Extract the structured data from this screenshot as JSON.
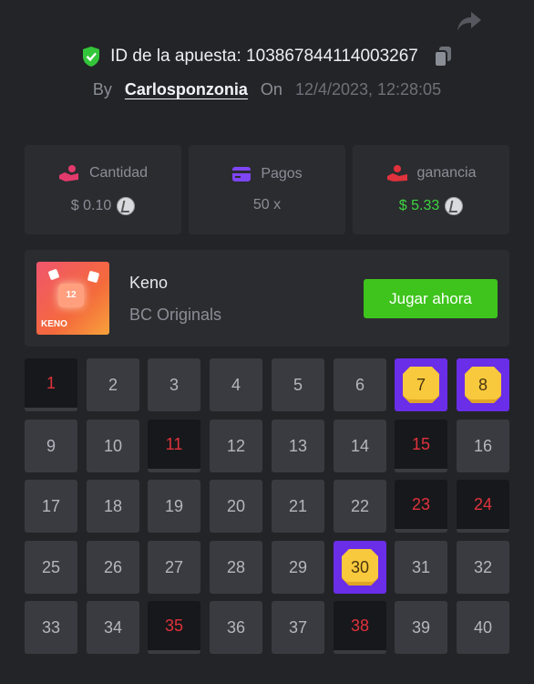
{
  "header": {
    "bet_id_label": "ID de la apuesta: 103867844114003267",
    "by_label": "By",
    "user": "Carlosponzonia",
    "on_label": "On",
    "date": "12/4/2023, 12:28:05"
  },
  "stats": [
    {
      "label": "Cantidad",
      "value": "$ 0.10",
      "icon": "hand-coins-icon"
    },
    {
      "label": "Pagos",
      "value": "50 x",
      "icon": "card-icon"
    },
    {
      "label": "ganancia",
      "value": "$ 5.33",
      "icon": "user-hand-icon"
    }
  ],
  "game": {
    "name": "Keno",
    "provider": "BC Originals",
    "play_label": "Jugar ahora",
    "thumb_number": "12",
    "thumb_label": "KENO"
  },
  "colors": {
    "accent_green": "#3ec41c",
    "hit_purple": "#6a2de8",
    "miss_red": "#e0323c"
  },
  "grid": {
    "cells": [
      {
        "n": "1",
        "s": "miss"
      },
      {
        "n": "2",
        "s": "plain"
      },
      {
        "n": "3",
        "s": "plain"
      },
      {
        "n": "4",
        "s": "plain"
      },
      {
        "n": "5",
        "s": "plain"
      },
      {
        "n": "6",
        "s": "plain"
      },
      {
        "n": "7",
        "s": "hit"
      },
      {
        "n": "8",
        "s": "hit"
      },
      {
        "n": "9",
        "s": "plain"
      },
      {
        "n": "10",
        "s": "plain"
      },
      {
        "n": "11",
        "s": "miss"
      },
      {
        "n": "12",
        "s": "plain"
      },
      {
        "n": "13",
        "s": "plain"
      },
      {
        "n": "14",
        "s": "plain"
      },
      {
        "n": "15",
        "s": "miss"
      },
      {
        "n": "16",
        "s": "plain"
      },
      {
        "n": "17",
        "s": "plain"
      },
      {
        "n": "18",
        "s": "plain"
      },
      {
        "n": "19",
        "s": "plain"
      },
      {
        "n": "20",
        "s": "plain"
      },
      {
        "n": "21",
        "s": "plain"
      },
      {
        "n": "22",
        "s": "plain"
      },
      {
        "n": "23",
        "s": "miss"
      },
      {
        "n": "24",
        "s": "miss"
      },
      {
        "n": "25",
        "s": "plain"
      },
      {
        "n": "26",
        "s": "plain"
      },
      {
        "n": "27",
        "s": "plain"
      },
      {
        "n": "28",
        "s": "plain"
      },
      {
        "n": "29",
        "s": "plain"
      },
      {
        "n": "30",
        "s": "hit"
      },
      {
        "n": "31",
        "s": "plain"
      },
      {
        "n": "32",
        "s": "plain"
      },
      {
        "n": "33",
        "s": "plain"
      },
      {
        "n": "34",
        "s": "plain"
      },
      {
        "n": "35",
        "s": "miss"
      },
      {
        "n": "36",
        "s": "plain"
      },
      {
        "n": "37",
        "s": "plain"
      },
      {
        "n": "38",
        "s": "miss"
      },
      {
        "n": "39",
        "s": "plain"
      },
      {
        "n": "40",
        "s": "plain"
      }
    ]
  }
}
